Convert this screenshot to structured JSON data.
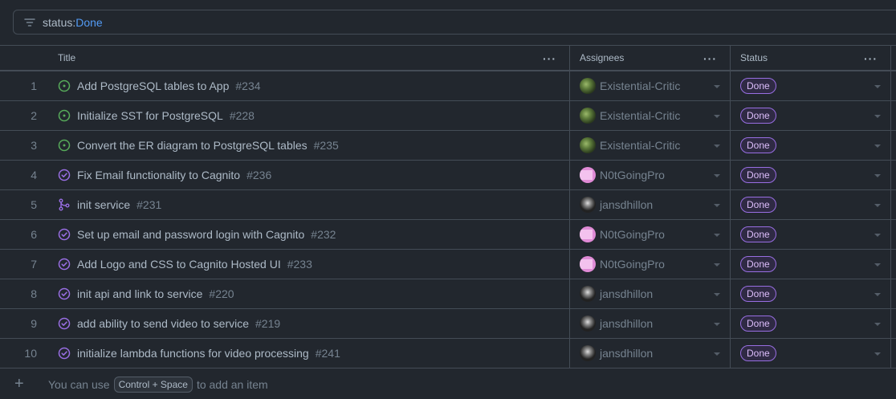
{
  "filter": {
    "key": "status:",
    "value": "Done"
  },
  "columns": {
    "title": "Title",
    "assignees": "Assignees",
    "status": "Status"
  },
  "rows": [
    {
      "n": "1",
      "title": "Add PostgreSQL tables to App",
      "num": "#234",
      "icon": "issue-open-icon",
      "assignee": "Existential-Critic",
      "avatar": "critic",
      "status": "Done"
    },
    {
      "n": "2",
      "title": "Initialize SST for PostgreSQL",
      "num": "#228",
      "icon": "issue-open-icon",
      "assignee": "Existential-Critic",
      "avatar": "critic",
      "status": "Done"
    },
    {
      "n": "3",
      "title": "Convert the ER diagram to PostgreSQL tables",
      "num": "#235",
      "icon": "issue-open-icon",
      "assignee": "Existential-Critic",
      "avatar": "critic",
      "status": "Done"
    },
    {
      "n": "4",
      "title": "Fix Email functionality to Cagnito",
      "num": "#236",
      "icon": "issue-closed-icon",
      "assignee": "N0tGoingPro",
      "avatar": "pro",
      "status": "Done"
    },
    {
      "n": "5",
      "title": "init service",
      "num": "#231",
      "icon": "pr-merged-icon",
      "assignee": "jansdhillon",
      "avatar": "jans",
      "status": "Done"
    },
    {
      "n": "6",
      "title": "Set up email and password login with Cagnito",
      "num": "#232",
      "icon": "issue-closed-icon",
      "assignee": "N0tGoingPro",
      "avatar": "pro",
      "status": "Done"
    },
    {
      "n": "7",
      "title": "Add Logo and CSS to Cagnito Hosted UI",
      "num": "#233",
      "icon": "issue-closed-icon",
      "assignee": "N0tGoingPro",
      "avatar": "pro",
      "status": "Done"
    },
    {
      "n": "8",
      "title": "init api and link to service",
      "num": "#220",
      "icon": "issue-closed-icon",
      "assignee": "jansdhillon",
      "avatar": "jans",
      "status": "Done"
    },
    {
      "n": "9",
      "title": "add ability to send video to service",
      "num": "#219",
      "icon": "issue-closed-icon",
      "assignee": "jansdhillon",
      "avatar": "jans",
      "status": "Done"
    },
    {
      "n": "10",
      "title": "initialize lambda functions for video processing",
      "num": "#241",
      "icon": "issue-closed-icon",
      "assignee": "jansdhillon",
      "avatar": "jans",
      "status": "Done"
    }
  ],
  "add_item": {
    "prefix": "You can use",
    "shortcut": "Control + Space",
    "suffix": "to add an item"
  },
  "colors": {
    "open": "#57ab5a",
    "closed": "#986ee2",
    "merged": "#986ee2"
  }
}
